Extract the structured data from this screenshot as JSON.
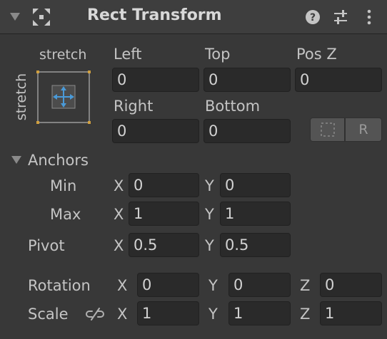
{
  "header": {
    "title": "Rect Transform"
  },
  "anchor_preset": {
    "horizontal_label": "stretch",
    "vertical_label": "stretch"
  },
  "offsets": {
    "left": {
      "label": "Left",
      "value": "0"
    },
    "top": {
      "label": "Top",
      "value": "0"
    },
    "pos_z": {
      "label": "Pos Z",
      "value": "0"
    },
    "right": {
      "label": "Right",
      "value": "0"
    },
    "bottom": {
      "label": "Bottom",
      "value": "0"
    },
    "raw_edit_label": "R"
  },
  "anchors": {
    "label": "Anchors",
    "min": {
      "label": "Min",
      "x_label": "X",
      "x": "0",
      "y_label": "Y",
      "y": "0"
    },
    "max": {
      "label": "Max",
      "x_label": "X",
      "x": "1",
      "y_label": "Y",
      "y": "1"
    }
  },
  "pivot": {
    "label": "Pivot",
    "x_label": "X",
    "x": "0.5",
    "y_label": "Y",
    "y": "0.5"
  },
  "rotation": {
    "label": "Rotation",
    "x_label": "X",
    "x": "0",
    "y_label": "Y",
    "y": "0",
    "z_label": "Z",
    "z": "0"
  },
  "scale": {
    "label": "Scale",
    "x_label": "X",
    "x": "1",
    "y_label": "Y",
    "y": "1",
    "z_label": "Z",
    "z": "1"
  },
  "colors": {
    "background": "#383838",
    "header": "#3e3e3e",
    "field": "#2a2a2a",
    "anchor_accent": "#4a9ad8",
    "corner_handle": "#d0a040"
  }
}
